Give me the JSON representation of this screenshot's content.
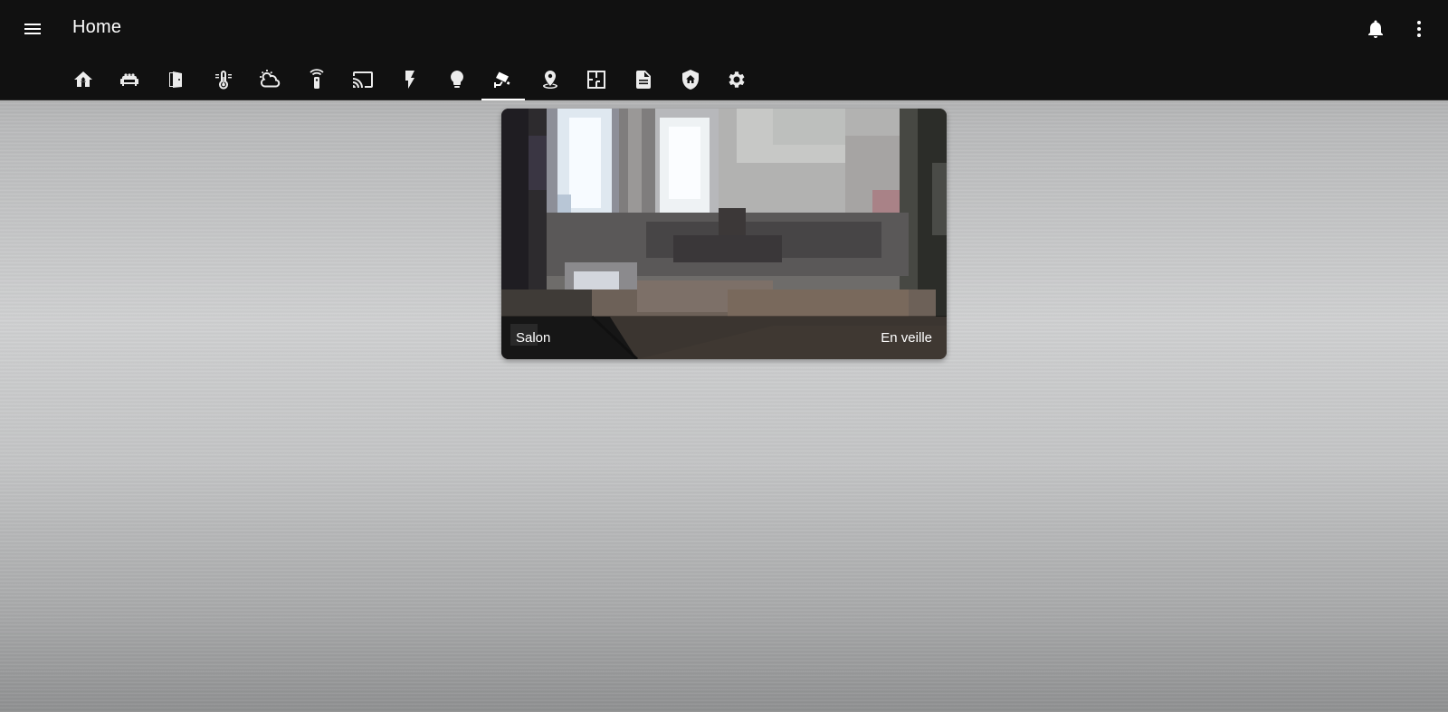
{
  "header": {
    "title": "Home",
    "menu_icon": "hamburger-menu-icon",
    "notifications_icon": "bell-icon",
    "overflow_icon": "vertical-dots-icon"
  },
  "tabs": [
    {
      "icon": "home-tree-icon",
      "active": false
    },
    {
      "icon": "sofa-icon",
      "active": false
    },
    {
      "icon": "door-icon",
      "active": false
    },
    {
      "icon": "thermometer-icon",
      "active": false
    },
    {
      "icon": "weather-partly-cloudy-icon",
      "active": false
    },
    {
      "icon": "remote-icon",
      "active": false
    },
    {
      "icon": "cast-icon",
      "active": false
    },
    {
      "icon": "flash-icon",
      "active": false
    },
    {
      "icon": "lightbulb-icon",
      "active": false
    },
    {
      "icon": "cctv-icon",
      "active": true
    },
    {
      "icon": "map-marker-icon",
      "active": false
    },
    {
      "icon": "floor-plan-icon",
      "active": false
    },
    {
      "icon": "file-document-icon",
      "active": false
    },
    {
      "icon": "shield-home-icon",
      "active": false
    },
    {
      "icon": "settings-gear-icon",
      "active": false
    }
  ],
  "camera": {
    "name": "Salon",
    "state": "En veille"
  },
  "colors": {
    "header_bg": "#111111",
    "accent": "#ffffff"
  }
}
